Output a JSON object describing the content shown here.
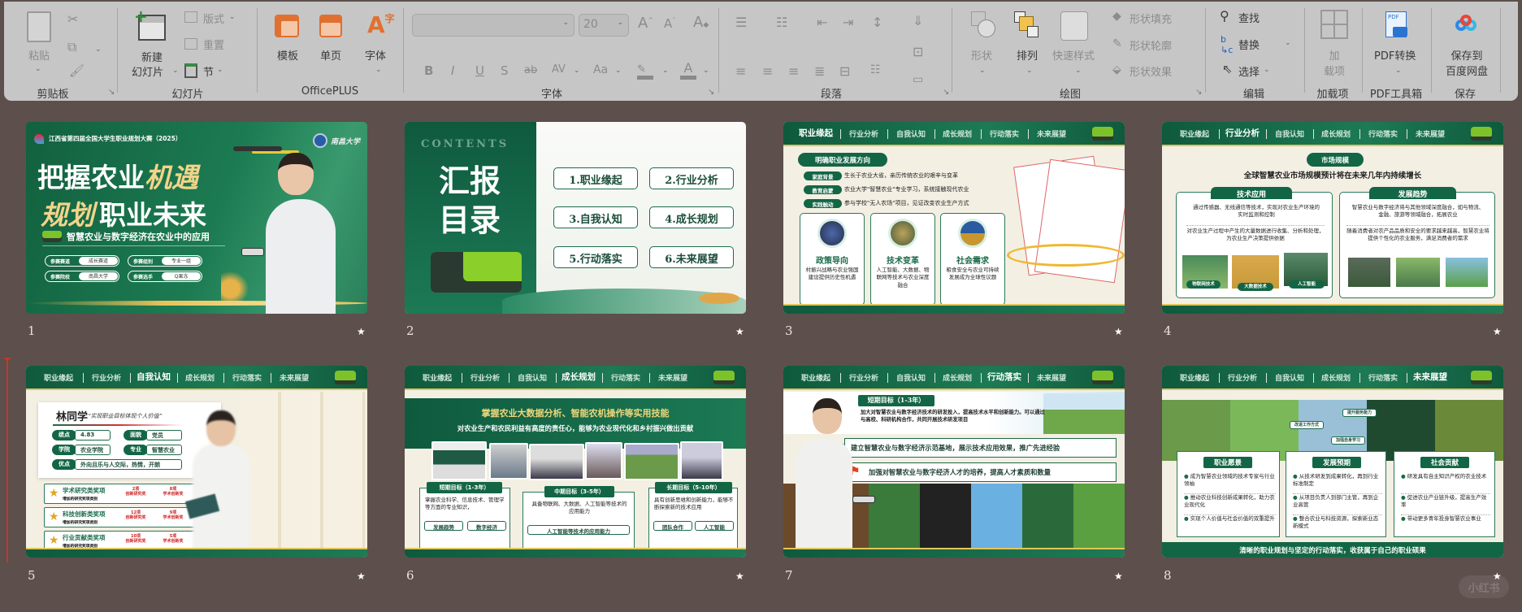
{
  "ribbon": {
    "clipboard": {
      "paste": "粘贴",
      "label": "剪贴板"
    },
    "slides": {
      "new_slide_line1": "新建",
      "new_slide_line2": "幻灯片",
      "layout": "版式",
      "reset": "重置",
      "section": "节",
      "label": "幻灯片"
    },
    "officeplus": {
      "template": "模板",
      "single_page": "单页",
      "font": "字体",
      "label": "OfficePLUS"
    },
    "font": {
      "font_name": "",
      "font_size": "20",
      "bold": "B",
      "italic": "I",
      "underline": "U",
      "shadow": "S",
      "strike": "ab",
      "spacing": "AV",
      "case": "Aa",
      "grow": "A",
      "shrink": "A",
      "color": "A",
      "label": "字体"
    },
    "paragraph": {
      "label": "段落"
    },
    "drawing": {
      "shape": "形状",
      "arrange": "排列",
      "quick_style": "快速样式",
      "fill": "形状填充",
      "outline": "形状轮廓",
      "effect": "形状效果",
      "label": "绘图"
    },
    "editing": {
      "find": "查找",
      "replace": "替换",
      "select": "选择",
      "label": "编辑"
    },
    "addins": {
      "button_line1": "加",
      "button_line2": "载项",
      "label": "加载项"
    },
    "pdf": {
      "convert": "PDF转换",
      "label": "PDF工具箱"
    },
    "save": {
      "line1": "保存到",
      "line2": "百度网盘",
      "label": "保存"
    }
  },
  "nav_tabs": [
    "职业缘起",
    "行业分析",
    "自我认知",
    "成长规划",
    "行动落实",
    "未来展望"
  ],
  "slides": [
    {
      "number": "1",
      "contest": "江西省第四届全国大学生职业规划大赛（2025）",
      "school_logo": "南昌大学",
      "title1_white": "把握农业",
      "title1_gold": "机遇",
      "title2_gold": "规划",
      "title2_white": "职业未来",
      "subtitle": "智慧农业与数字经济在农业中的应用",
      "fields": [
        {
          "label": "参赛赛道",
          "value": "成长赛道"
        },
        {
          "label": "参赛组别",
          "value": "专业一组"
        },
        {
          "label": "参赛院校",
          "value": "南昌大学"
        },
        {
          "label": "参赛选手",
          "value": "Q果冻"
        }
      ]
    },
    {
      "number": "2",
      "contents": "CONTENTS",
      "title1": "汇报",
      "title2": "目录",
      "items": [
        "1.职业缘起",
        "2.行业分析",
        "3.自我认知",
        "4.成长规划",
        "5.行动落实",
        "6.未来展望"
      ]
    },
    {
      "number": "3",
      "heading": "明确职业发展方向",
      "rows": [
        {
          "tag": "家庭背景",
          "text": "生长于农业大省，亲历传统农业的艰辛与变革"
        },
        {
          "tag": "教育启蒙",
          "text": "农业大学\"智慧农业\"专业学习，系统接触现代农业"
        },
        {
          "tag": "实践触动",
          "text": "参与学校\"无人农场\"项目，见证改变农业生产方式"
        }
      ],
      "cards": [
        {
          "title": "政策导向",
          "text": "村振兴战略与农业强国建设提供历史性机遇"
        },
        {
          "title": "技术变革",
          "text": "人工智能、大数据、物联网等技术与农业深度融合"
        },
        {
          "title": "社会需求",
          "text": "粮食安全与农业可持续发展成为全球性议题"
        }
      ]
    },
    {
      "number": "4",
      "pill": "市场规模",
      "headline": "全球智慧农业市场规模预计将在未来几年内持续增长",
      "left_title": "技术应用",
      "left_texts": [
        "通过传感器、无线通信等技术，实现对农业生产环境的实时监测和控制",
        "对农业生产过程中产生的大量数据进行收集、分析和处理，为农业生产决策提供依据"
      ],
      "left_tags": [
        "物联网技术",
        "大数据技术",
        "人工智能"
      ],
      "right_title": "发展趋势",
      "right_texts": [
        "智慧农业与数字经济将与其他领域深度融合，如与物流、金融、旅游等领域融合，拓展农业",
        "随着消费者对农产品品质和安全的要求越来越高，智慧农业将提供个性化的农业服务，满足消费者的需求"
      ]
    },
    {
      "number": "5",
      "name": "林同学",
      "quote": "“实现职业目标体现个人价值”",
      "fields": [
        {
          "label": "绩点",
          "value": "4.83"
        },
        {
          "label": "面貌",
          "value": "党员"
        },
        {
          "label": "学院",
          "value": "农业学院"
        },
        {
          "label": "专业",
          "value": "智慧农业"
        },
        {
          "label": "优点",
          "value": "外向且乐与人交际，热情，开朗"
        }
      ],
      "awards": [
        {
          "title": "学术研究类奖项",
          "sub": "增加的研究奖项类别",
          "b1n": "2项",
          "b1": "创新研究奖",
          "b2n": "8项",
          "b2": "学术创新奖"
        },
        {
          "title": "科技创新类奖项",
          "sub": "增加的研究奖项类别",
          "b1n": "12项",
          "b1": "创新研究奖",
          "b2n": "9项",
          "b2": "学术创新奖"
        },
        {
          "title": "行业贡献类奖项",
          "sub": "增加的研究奖项类别",
          "b1n": "10项",
          "b1": "创新研究奖",
          "b2n": "5项",
          "b2": "学术创新奖"
        }
      ]
    },
    {
      "number": "6",
      "headline": "掌握农业大数据分析、智能农机操作等实用技能",
      "subline": "对农业生产和农民利益有高度的责任心，能够为农业现代化和乡村振兴做出贡献",
      "goals": [
        {
          "title": "短期目标（1-3年）",
          "text": "掌握农业科学、信息技术、管理学等方面的专业知识，",
          "tags": [
            "发展趋势",
            "数字经济"
          ]
        },
        {
          "title": "中期目标（3-5年）",
          "text": "具备物联网、大数据、人工智能等技术的应用能力",
          "tags": [
            "人工智能等技术的应用能力"
          ]
        },
        {
          "title": "长期目标（5-10年）",
          "text": "具有创新思维和创新能力，能够不断探索新的技术应用",
          "tags": [
            "团队合作",
            "人工智能"
          ]
        }
      ]
    },
    {
      "number": "7",
      "tab": "短期目标（1-3年）",
      "text": "加大对智慧农业与数字经济技术的研发投入，提高技术水平和创新能力。可以通过与高校、科研机构合作，共同开展技术研发项目",
      "banner1": "建立智慧农业与数字经济示范基地，展示技术应用效果，推广先进经验",
      "banner2": "加强对智慧农业与数字经济人才的培养，提高人才素质和数量"
    },
    {
      "number": "8",
      "callouts": [
        "提升服务能力",
        "改进工作方式",
        "加强自身学习"
      ],
      "cards": [
        {
          "title": "职业愿景",
          "items": [
            "成为智慧农业领域的技术专家与行业领袖",
            "推动农业科技创新成果转化，助力农业现代化",
            "实现个人价值与社会价值的双重提升"
          ]
        },
        {
          "title": "发展预期",
          "items": [
            "从技术研发到成果转化，再到行业标准制定",
            "从项目负责人到部门主管，再到企业高管",
            "整合农业与科技资源，探索新业态新模式"
          ]
        },
        {
          "title": "社会贡献",
          "items": [
            "研发具有自主知识产权的农业技术",
            "促进农业产业链升级，提高生产效率",
            "带动更多青年投身智慧农业事业"
          ]
        }
      ],
      "footer": "清晰的职业规划与坚定的行动落实，收获属于自己的职业硕果"
    }
  ],
  "watermark": "小红书",
  "colors": {
    "bg": "#5d4f4c",
    "ribbon": "#c6c6c6",
    "green": "#136645",
    "gold": "#e2c55a"
  }
}
